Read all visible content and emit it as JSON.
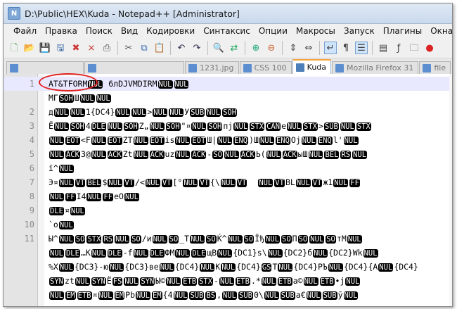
{
  "window": {
    "title": "D:\\Public\\HEX\\Kuda - Notepad++ [Administrator]"
  },
  "menu": [
    "Файл",
    "Правка",
    "Поиск",
    "Вид",
    "Кодировки",
    "Синтаксис",
    "Опции",
    "Макросы",
    "Запуск",
    "Плагины",
    "Окна",
    "?"
  ],
  "toolbar": [
    "new-file-icon",
    "open-file-icon",
    "save-icon",
    "save-all-icon",
    "close-icon",
    "close-all-icon",
    "print-icon",
    "sep",
    "cut-icon",
    "copy-icon",
    "paste-icon",
    "sep",
    "undo-icon",
    "redo-icon",
    "sep",
    "find-icon",
    "replace-icon",
    "sep",
    "zoom-in-icon",
    "zoom-out-icon",
    "sep",
    "sync-v-icon",
    "sync-h-icon",
    "sep",
    "wrap-icon",
    "show-all-icon",
    "indent-guide-icon",
    "sep",
    "doc-map-icon",
    "function-list-icon",
    "folder-icon",
    "record-icon"
  ],
  "tabs": [
    {
      "label": "",
      "active": false
    },
    {
      "label": "",
      "active": false
    },
    {
      "label": "1231.jpg",
      "active": false
    },
    {
      "label": "CSS 100",
      "active": false
    },
    {
      "label": "Kuda",
      "active": true
    },
    {
      "label": "Mozilla Firefox 31",
      "active": false
    },
    {
      "label": "file",
      "active": false
    }
  ],
  "editor": {
    "current_line": 1,
    "lines": [
      {
        "n": "1",
        "text": "AT&TFORM{NUL} 6лDJVMDIRM{NUL}{NUL}"
      },
      {
        "n": "",
        "text": "MГ{SOH}Ш{NUL}{NUL}"
      },
      {
        "n": "2",
        "text": "д{NUL}{NUL}1{DC4}{NUL}{NUL}>{NUL}{NUL}У{SUB}{NUL}{SOH}"
      },
      {
        "n": "3",
        "text": "Ё{NUL}{SOH}4{DLE}{NUL}{SOH}Z„{NUL}{SOH}\"¤{NUL}{SOH}пj{NUL}{STX}{CAN}е{NUL}{STX}>{SUB}{NUL}{STX}"
      },
      {
        "n": "4",
        "text": "{NUL}{EOT}<F{NUL}{EOT}ZT{NUL}{EOT}is{NUL}{EOT}Ш|{NUL}{ENQ})Ш{NUL}{ENQ}Oj{NUL}{ENQ}l'{NUL}"
      },
      {
        "n": "5",
        "text": "{NUL}{ACK}3@{NUL}{ACK}Zt{NUL}{ACK}uz{NUL}{ACK}-{SO}{NUL}{ACK}Ь({NUL}{ACK}ыШ{NUL}{BEL}{RS}{NUL}"
      },
      {
        "n": "6",
        "text": "ї^{NUL}"
      },
      {
        "n": "7",
        "text": "Э¤{NUL}{VT}{BEL}${NUL}{VT}/<{NUL}{VT}[°{NUL}{VT}{\\{NUL}{VT}  {NUL}{VT}BL{NUL}{VT}ж1{NUL}{FF}"
      },
      {
        "n": "8",
        "text": "{NUL}{FF}I4{NUL}{FF}еO{NUL}"
      },
      {
        "n": "9",
        "text": "{DLE}¤{NUL}"
      },
      {
        "n": "10",
        "text": "`o{NUL}"
      },
      {
        "n": "11",
        "text": "Ы^{NUL}{SO}{STX}{RS}{NUL}{SO}/и{NUL}{SO}_T{NUL}{SO}Ќ^{NUL}{SO}Ïђ{NUL}{SO}П{SO}{NUL}{SO}тМ{NUL}"
      },
      {
        "n": "",
        "text": "{NUL}{DLE}…K{NUL}{DLE}-f{NUL}{DLE}ФМ{NUL}{DLE}щВ{NUL}{DC1}s\\{NUL}{DC2}б{NUL}{DC2}Wk{NUL}"
      },
      {
        "n": "",
        "text": "%X{NUL}{DC3}-ю{NUL}{DC3}ве{NUL}{DC4}{NUL}K{NUL}{DC4}{GS}T{NUL}{DC4}РЪ{NUL}{DC4}{A{NUL}{DC4}"
      },
      {
        "n": "",
        "text": "{SYN}zt{NUL}{SYN}Ё{FS}{NUL}{SYN}Ы©{NUL}{ETB}{STX}-{NUL}{ETB}.*{NUL}{ETB}а©{NUL}{ETB}•j{NUL}"
      },
      {
        "n": "",
        "text": "{NUL}{EM}{ETB}¤{NUL}{EM}Pb{NUL}{EM}{4{NUL}{SUB}{BS},{NUL}{SUB}0\\{NUL}{SUB}а€{NUL}{SUB}ў{NUL}"
      }
    ]
  },
  "colors": {
    "annotation": "#e02020",
    "current_line": "#e8e8ff",
    "active_tab_top": "#f5a43a"
  }
}
